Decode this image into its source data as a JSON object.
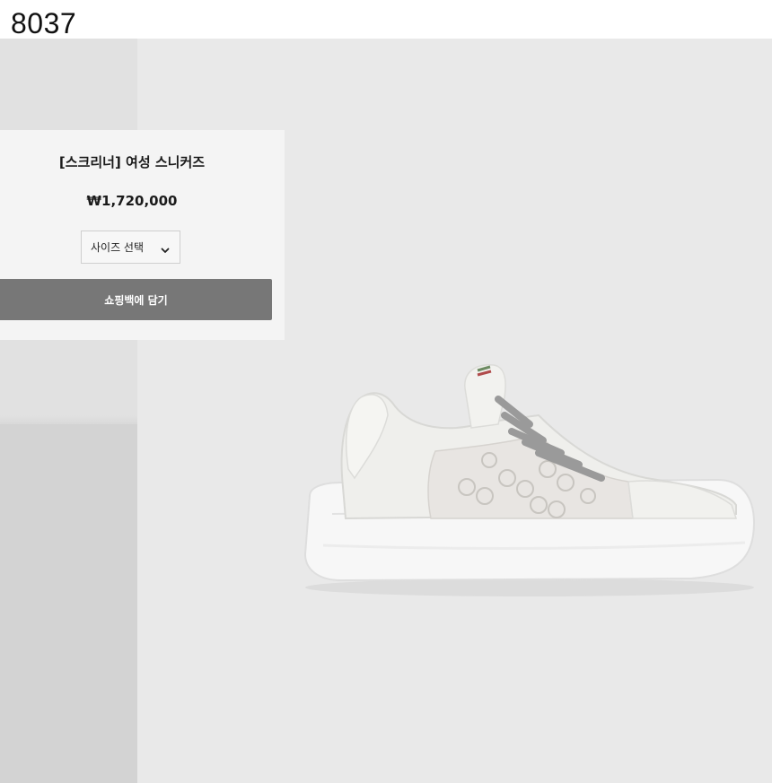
{
  "page_label": "8037",
  "product": {
    "title": "[스크리너] 여성 스니커즈",
    "price": "₩1,720,000",
    "size_select_label": "사이즈 선택",
    "add_to_bag_label": "쇼핑백에 담기",
    "image_icon": "sneaker-photo"
  },
  "colors": {
    "background": "#e9e9e9",
    "card": "#f4f4f4",
    "button": "#777777",
    "button_text": "#ffffff"
  }
}
